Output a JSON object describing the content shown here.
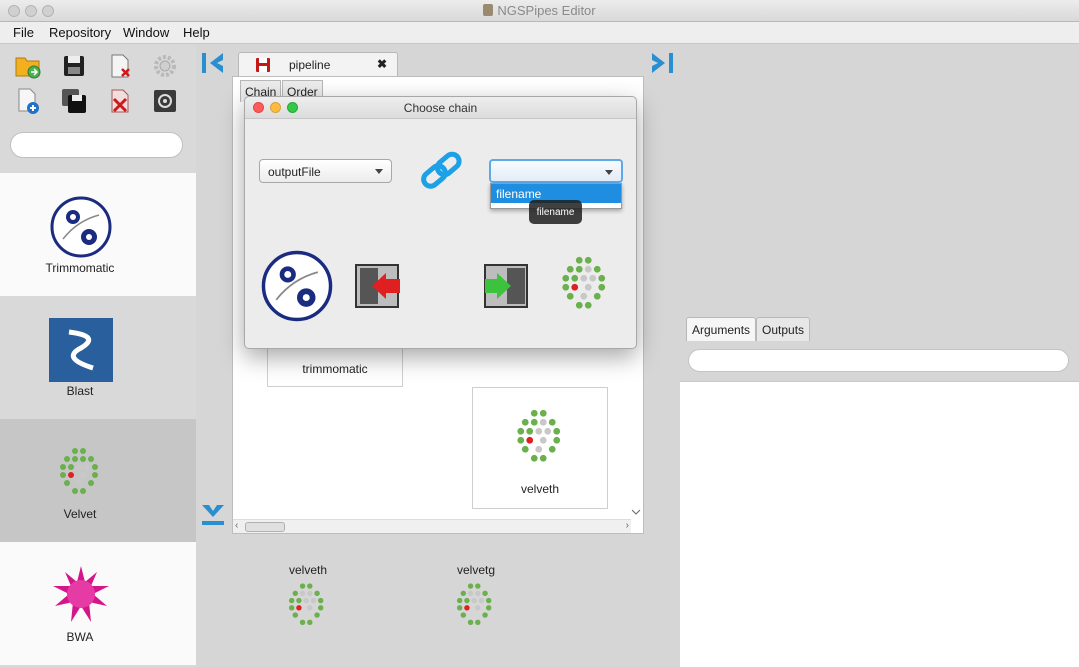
{
  "window": {
    "title": "NGSPipes Editor"
  },
  "menu": [
    "File",
    "Repository",
    "Window",
    "Help"
  ],
  "toolbar_icons": [
    "open-folder-icon",
    "save-icon",
    "delete-file-icon",
    "settings-icon",
    "new-file-icon",
    "save-all-icon",
    "delete-red-icon",
    "preferences-icon"
  ],
  "tools": [
    {
      "label": "Trimmomatic",
      "icon": "trimmomatic-icon"
    },
    {
      "label": "Blast",
      "icon": "blast-icon"
    },
    {
      "label": "Velvet",
      "icon": "velvet-icon"
    },
    {
      "label": "BWA",
      "icon": "bwa-icon"
    }
  ],
  "editor": {
    "tab_label": "pipeline",
    "tab_close": "✖",
    "subtabs": [
      "Chain",
      "Order"
    ],
    "nodes": [
      {
        "label": "trimmomatic"
      },
      {
        "label": "velveth"
      }
    ]
  },
  "bottom_tools": [
    {
      "label": "velveth"
    },
    {
      "label": "velvetg"
    }
  ],
  "right_panel": {
    "tabs": [
      "Arguments",
      "Outputs"
    ]
  },
  "dialog": {
    "title": "Choose chain",
    "left_select": "outputFile",
    "right_select": "",
    "dropdown_option": "filename",
    "tooltip": "filename"
  },
  "colors": {
    "accent_blue": "#1f8ee0",
    "focus_ring": "#5ea9e8",
    "arrow_red": "#e02020",
    "arrow_green": "#3cc23c",
    "velvet_green": "#6ab04c"
  }
}
